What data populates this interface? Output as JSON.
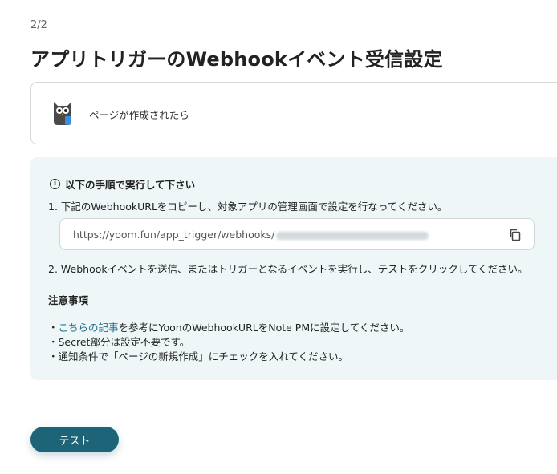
{
  "header": {
    "step": "2/2",
    "title": "アプリトリガーのWebhookイベント受信設定"
  },
  "trigger": {
    "label": "ページが作成されたら",
    "icon": "noteapp-owl-icon"
  },
  "instructions": {
    "heading": "以下の手順で実行して下さい",
    "step1": "1. 下記のWebhookURLをコピーし、対象アプリの管理画面で設定を行なってください。",
    "url_prefix": "https://yoom.fun/app_trigger/webhooks/",
    "step2": "2. Webhookイベントを送信、またはトリガーとなるイベントを実行し、テストをクリックしてください。",
    "notes_heading": "注意事項",
    "note1_prefix": "・",
    "note1_link": "こちらの記事",
    "note1_suffix": "を参考にYoonのWebhookURLをNote PMに設定してください。",
    "note2": "・Secret部分は設定不要です。",
    "note3": "・通知条件で「ページの新規作成」にチェックを入れてください。"
  },
  "actions": {
    "test_label": "テスト"
  },
  "colors": {
    "accent": "#1e6478",
    "link": "#1e6f86",
    "panel_bg": "#eef6f7"
  }
}
